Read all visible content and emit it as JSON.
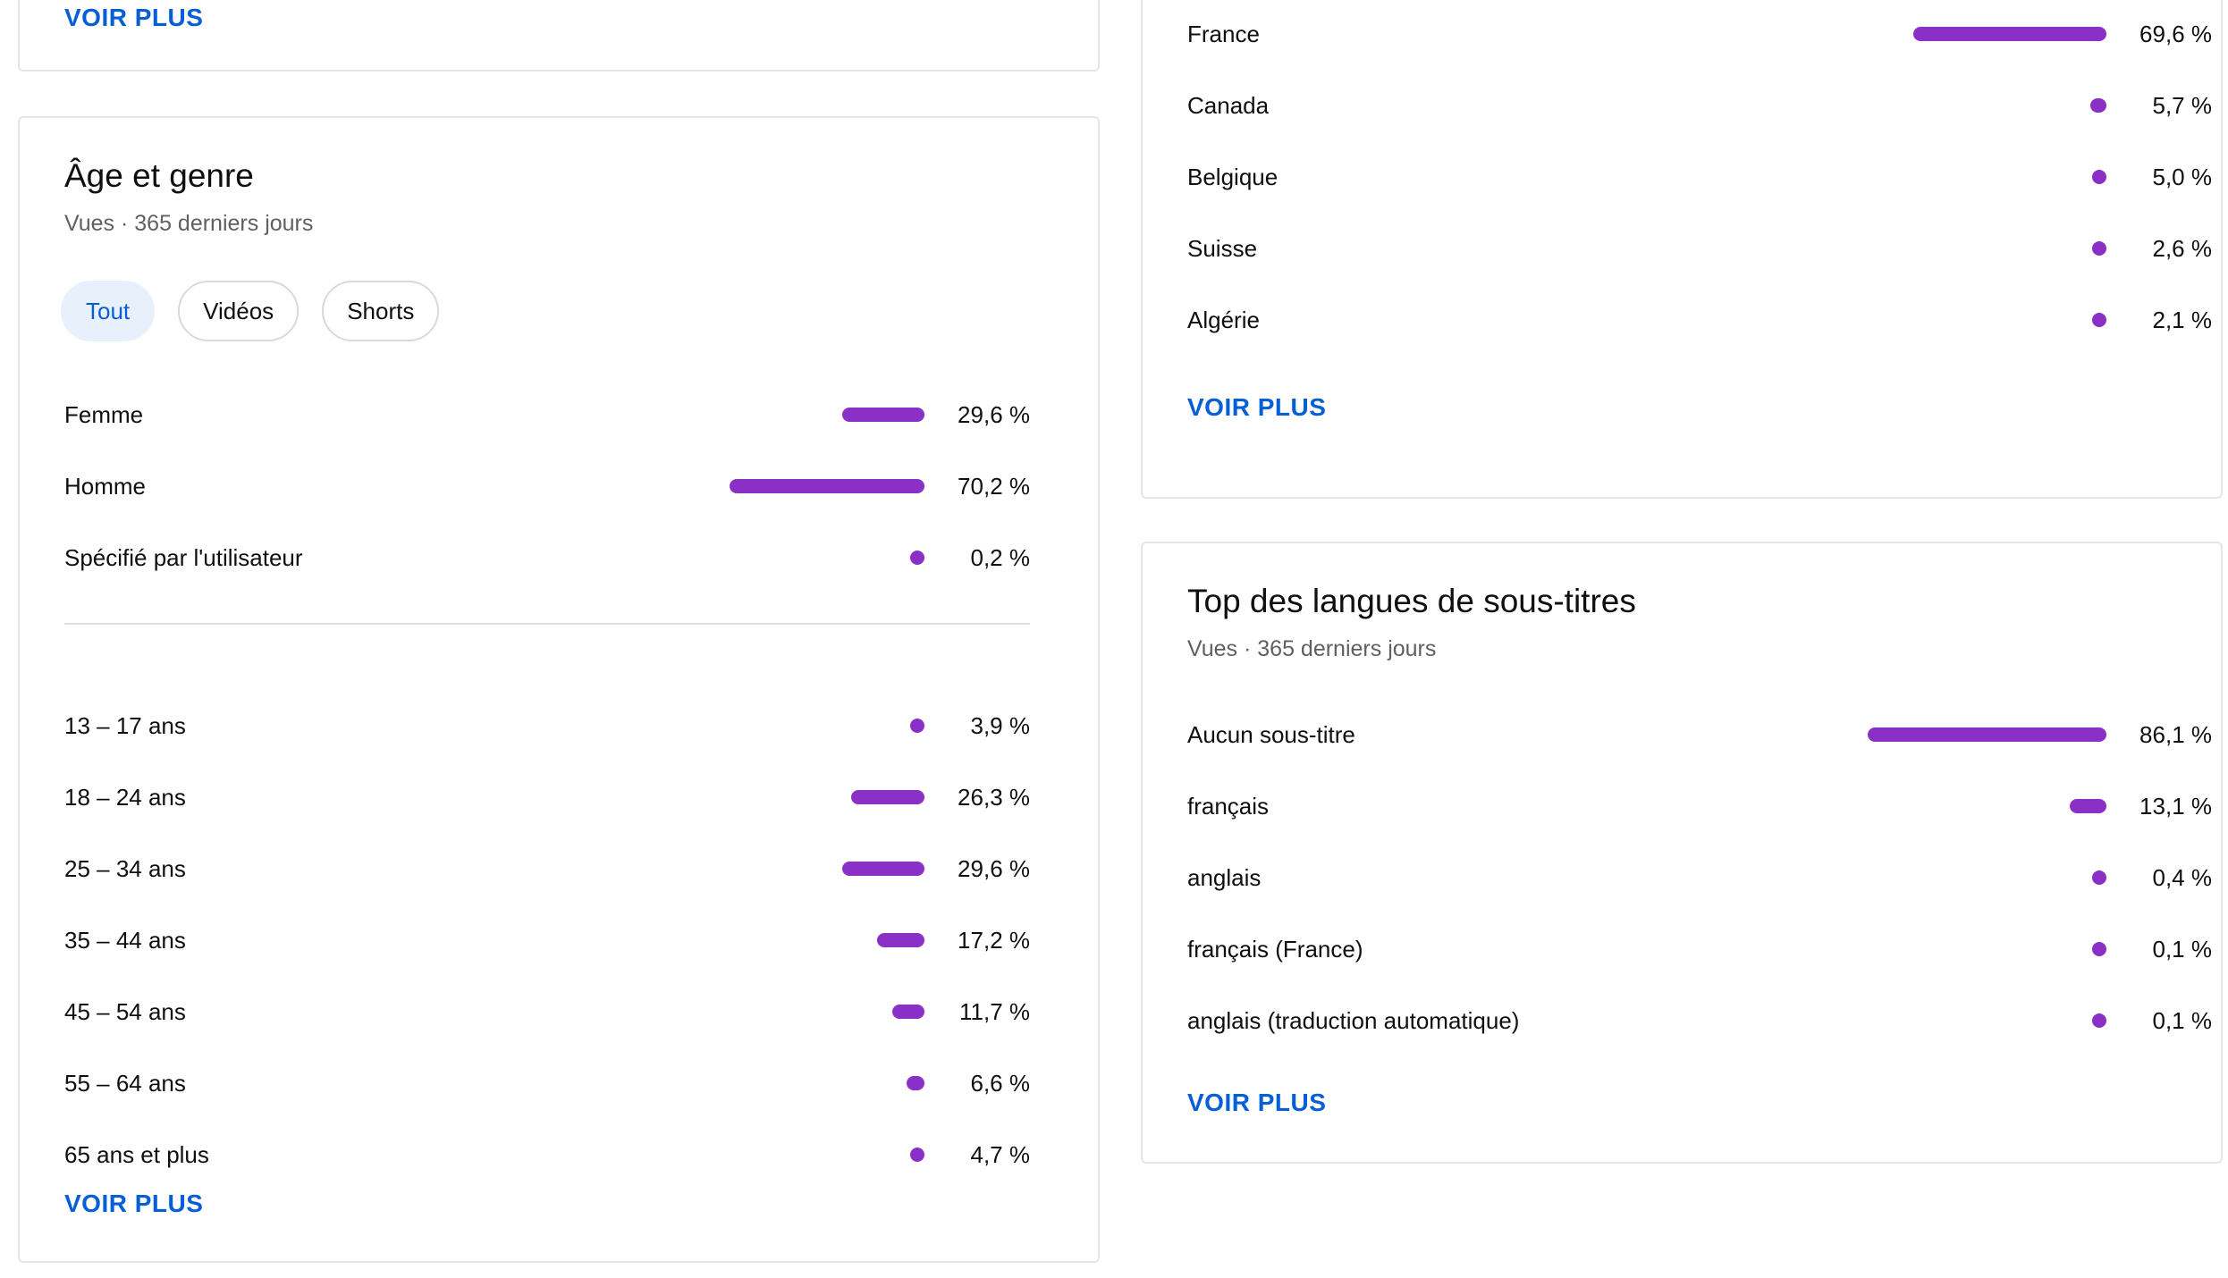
{
  "colors": {
    "bar": "#8b30c6",
    "link": "#065fd4",
    "chip_active_bg": "#e8f0fb"
  },
  "top_left_card": {
    "voir_plus": "VOIR PLUS"
  },
  "age_gender": {
    "title": "Âge et genre",
    "subtitle": "Vues · 365 derniers jours",
    "chips": [
      {
        "label": "Tout",
        "active": true
      },
      {
        "label": "Vidéos",
        "active": false
      },
      {
        "label": "Shorts",
        "active": false
      }
    ],
    "gender_rows": [
      {
        "label": "Femme",
        "value": 29.6,
        "pct": "29,6 %"
      },
      {
        "label": "Homme",
        "value": 70.2,
        "pct": "70,2 %"
      },
      {
        "label": "Spécifié par l'utilisateur",
        "value": 0.2,
        "pct": "0,2 %"
      }
    ],
    "age_rows": [
      {
        "label": "13 – 17 ans",
        "value": 3.9,
        "pct": "3,9 %"
      },
      {
        "label": "18 – 24 ans",
        "value": 26.3,
        "pct": "26,3 %"
      },
      {
        "label": "25 – 34 ans",
        "value": 29.6,
        "pct": "29,6 %"
      },
      {
        "label": "35 – 44 ans",
        "value": 17.2,
        "pct": "17,2 %"
      },
      {
        "label": "45 – 54 ans",
        "value": 11.7,
        "pct": "11,7 %"
      },
      {
        "label": "55 – 64 ans",
        "value": 6.6,
        "pct": "6,6 %"
      },
      {
        "label": "65 ans et plus",
        "value": 4.7,
        "pct": "4,7 %"
      }
    ],
    "voir_plus": "VOIR PLUS"
  },
  "countries": {
    "rows": [
      {
        "label": "France",
        "value": 69.6,
        "pct": "69,6 %"
      },
      {
        "label": "Canada",
        "value": 5.7,
        "pct": "5,7 %"
      },
      {
        "label": "Belgique",
        "value": 5.0,
        "pct": "5,0 %"
      },
      {
        "label": "Suisse",
        "value": 2.6,
        "pct": "2,6 %"
      },
      {
        "label": "Algérie",
        "value": 2.1,
        "pct": "2,1 %"
      }
    ],
    "voir_plus": "VOIR PLUS"
  },
  "subtitles": {
    "title": "Top des langues de sous-titres",
    "subtitle": "Vues · 365 derniers jours",
    "rows": [
      {
        "label": "Aucun sous-titre",
        "value": 86.1,
        "pct": "86,1 %"
      },
      {
        "label": "français",
        "value": 13.1,
        "pct": "13,1 %"
      },
      {
        "label": "anglais",
        "value": 0.4,
        "pct": "0,4 %"
      },
      {
        "label": "français (France)",
        "value": 0.1,
        "pct": "0,1 %"
      },
      {
        "label": "anglais (traduction automatique)",
        "value": 0.1,
        "pct": "0,1 %"
      }
    ],
    "voir_plus": "VOIR PLUS"
  }
}
